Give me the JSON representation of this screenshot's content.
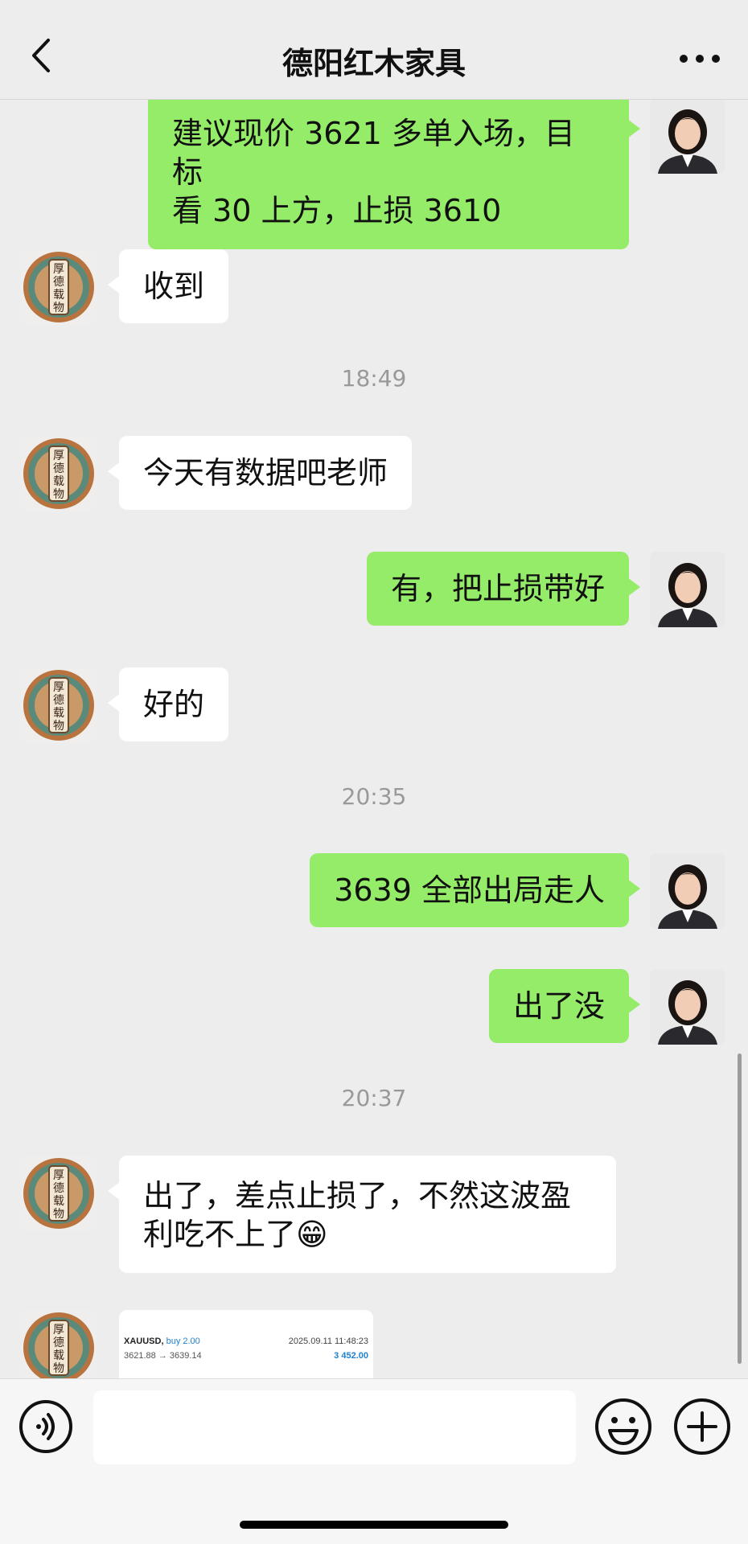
{
  "header": {
    "title": "德阳红木家具"
  },
  "messages": [
    {
      "side": "right",
      "lines": [
        "建议现价 3621 多单入场，目标",
        "看 30 上方，止损 3610"
      ]
    },
    {
      "side": "left",
      "text": "收到"
    },
    {
      "timestamp": "18:49"
    },
    {
      "side": "left",
      "text": "今天有数据吧老师"
    },
    {
      "side": "right",
      "text": "有，把止损带好"
    },
    {
      "side": "left",
      "text": "好的"
    },
    {
      "timestamp": "20:35"
    },
    {
      "side": "right",
      "text": "3639 全部出局走人"
    },
    {
      "side": "right",
      "text": "出了没"
    },
    {
      "timestamp": "20:37"
    },
    {
      "side": "left",
      "lines": [
        "出了，差点止损了，不然这波盈",
        "利吃不上了😁"
      ]
    }
  ],
  "trade_card": {
    "symbol": "XAUUSD,",
    "side": "buy 2.00",
    "datetime": "2025.09.11 11:48:23",
    "prices": "3621.88 → 3639.14",
    "profit": "3 452.00"
  },
  "left_avatar": {
    "seal_text": [
      "厚",
      "德",
      "载",
      "物"
    ]
  },
  "footer": {
    "input_placeholder": ""
  },
  "icons": {
    "back": "chevron-left-icon",
    "more": "more-icon",
    "voice": "voice-icon",
    "emoji": "emoji-icon",
    "plus": "plus-icon"
  },
  "colors": {
    "sent_bubble": "#95ec69",
    "received_bubble": "#ffffff",
    "background": "#ededed"
  }
}
